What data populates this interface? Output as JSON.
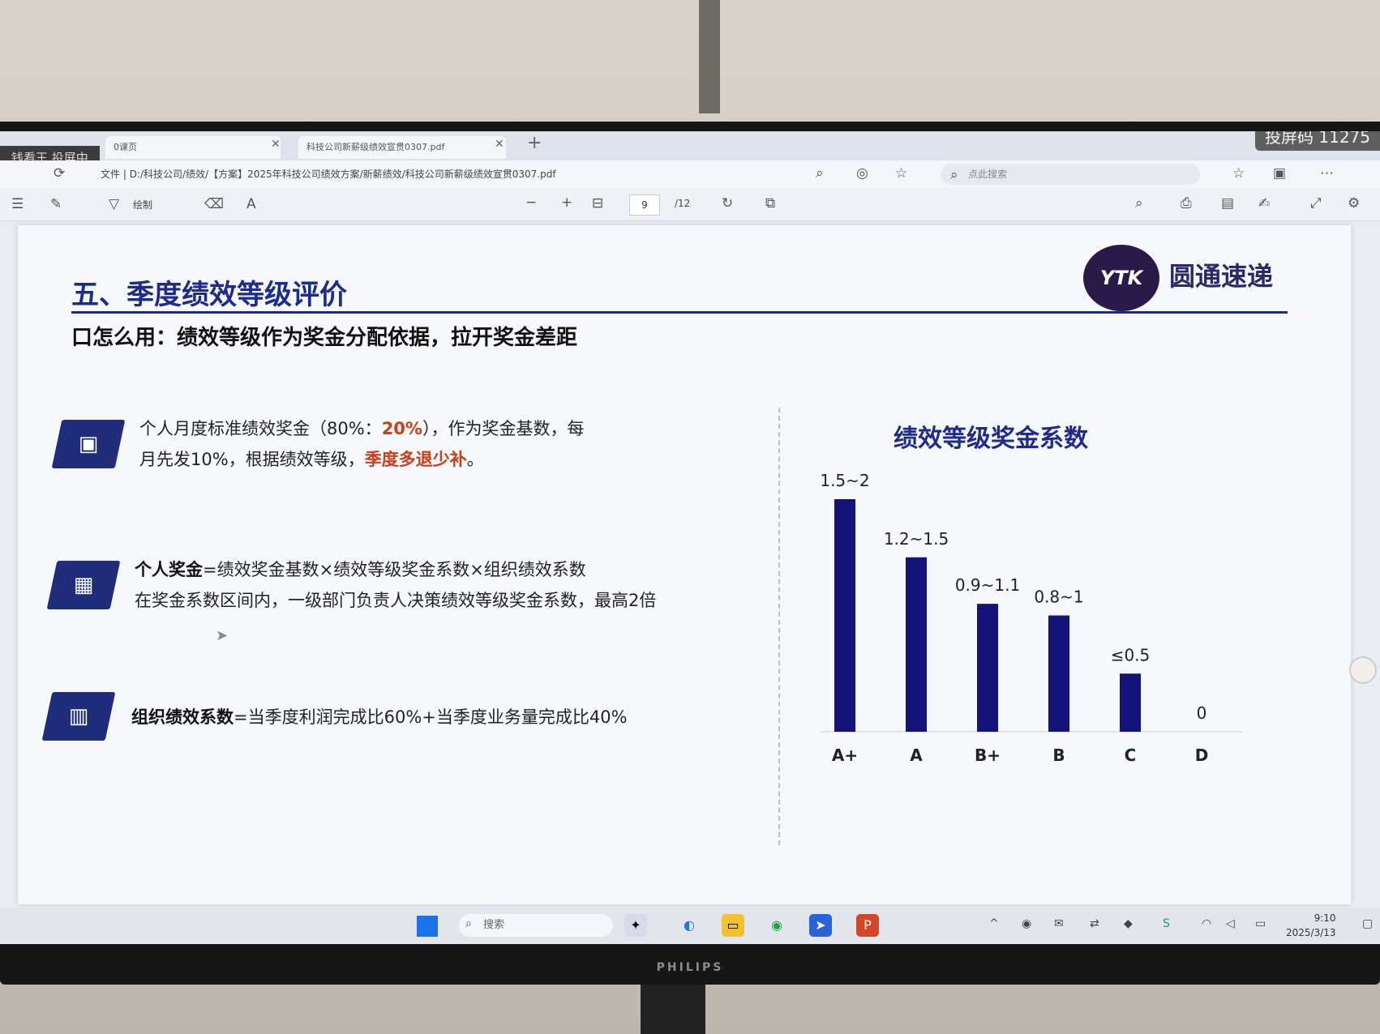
{
  "overlay": {
    "cast_status": "钱看王 投屏中",
    "cast_code": "投屏码 11275"
  },
  "browser": {
    "tabs": [
      {
        "label": "0课页"
      },
      {
        "label": "科技公司新薪级绩效宣贯0307.pdf"
      }
    ],
    "address_prefix": "文件",
    "address": "D:/科技公司/绩效/【方案】2025年科技公司绩效方案/新薪绩效/科技公司新薪级绩效宣贯0307.pdf",
    "search_placeholder": "点此搜索",
    "toolbar_draw_label": "绘制",
    "page_current": "9",
    "page_total": "/12"
  },
  "slide": {
    "logo_text": "YTK",
    "brand_name": "圆通速递",
    "title": "五、季度绩效等级评价",
    "subtitle": "口怎么用：绩效等级作为奖金分配依据，拉开奖金差距",
    "block1": {
      "line1_pre": "个人月度标准绩效奖金（80%：",
      "line1_highlight": "20%",
      "line1_post": "），作为奖金基数，每",
      "line2_pre": "月先发10%，根据绩效等级，",
      "line2_highlight": "季度多退少补",
      "line2_post": "。"
    },
    "block2": {
      "line1_bold": "个人奖金",
      "line1_rest": "=绩效奖金基数×绩效等级奖金系数×组织绩效系数",
      "line2": "在奖金系数区间内，一级部门负责人决策绩效等级奖金系数，最高2倍"
    },
    "block3": {
      "bold": "组织绩效系数",
      "rest": "=当季度利润完成比60%+当季度业务量完成比40%"
    }
  },
  "chart_data": {
    "type": "bar",
    "title": "绩效等级奖金系数",
    "categories": [
      "A+",
      "A",
      "B+",
      "B",
      "C",
      "D"
    ],
    "values": [
      2.0,
      1.5,
      1.1,
      1.0,
      0.5,
      0
    ],
    "data_labels": [
      "1.5~2",
      "1.2~1.5",
      "0.9~1.1",
      "0.8~1",
      "≤0.5",
      "0"
    ],
    "ylim": [
      0,
      2.0
    ],
    "grid": false,
    "bar_color": "#14137a"
  },
  "taskbar": {
    "search_label": "搜索",
    "time": "9:10",
    "date": "2025/3/13"
  },
  "monitor": {
    "brand": "PHILIPS"
  }
}
